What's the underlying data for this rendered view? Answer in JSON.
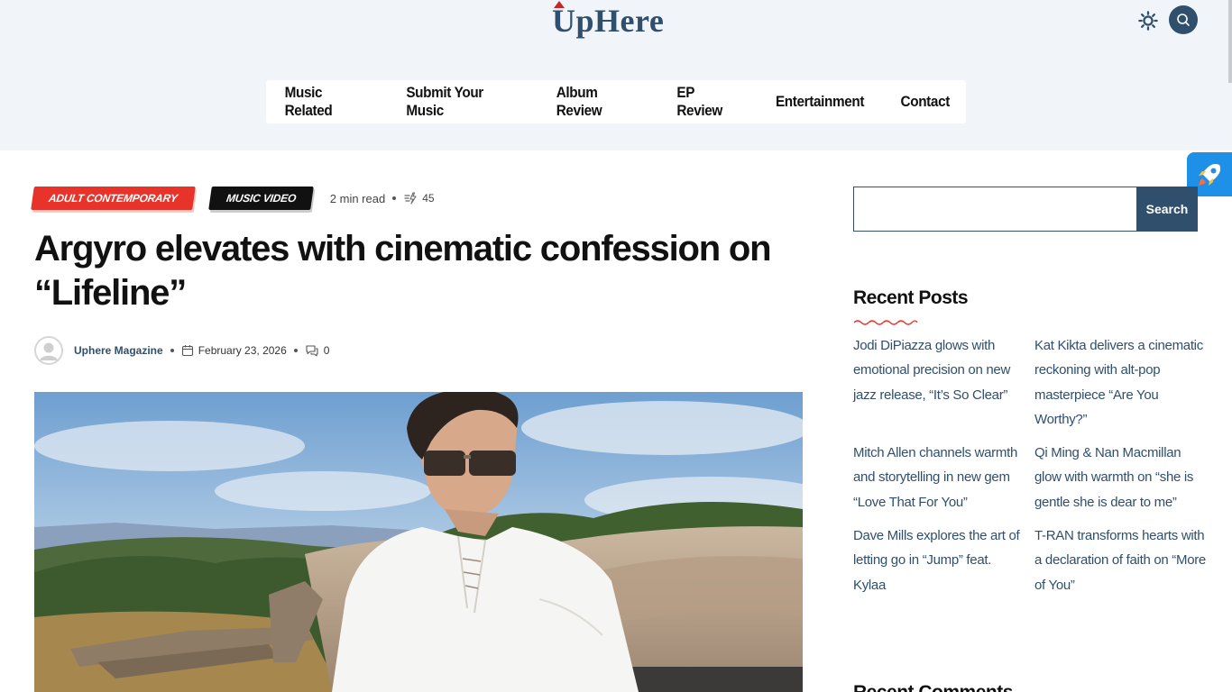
{
  "header": {
    "logo_text": "UpHere",
    "nav": [
      "Music Related",
      "Submit Your Music",
      "Album Review",
      "EP Review",
      "Entertainment",
      "Contact"
    ]
  },
  "article": {
    "tags": [
      "ADULT CONTEMPORARY",
      "MUSIC VIDEO"
    ],
    "read_time": "2 min read",
    "views": "45",
    "title": "Argyro elevates with cinematic confession on “Lifeline”",
    "author": "Uphere Magazine",
    "date": "February 23, 2026",
    "comments": "0"
  },
  "sidebar": {
    "search_button": "Search",
    "search_value": "",
    "recent_posts_title": "Recent Posts",
    "recent_posts": [
      "Jodi DiPiazza glows with emotional precision on new jazz release, “It’s So Clear”",
      "Kat Kikta delivers a cinematic reckoning with alt-pop masterpiece “Are You Worthy?”",
      "Mitch Allen channels warmth and storytelling in new gem “Love That For You”",
      "Qi Ming & Nan Macmillan glow with warmth on “she is gentle she is dear to me”",
      "Dave Mills explores the art of letting go in “Jump” feat. Kylaa",
      "T-RAN transforms hearts with a declaration of faith on “More of You”"
    ],
    "recent_comments_title": "Recent Comments"
  },
  "colors": {
    "brand": "#2f4f6c",
    "tag_red": "#e8332b",
    "rocket_blue": "#1e90e8",
    "header_bg": "#f1f5fa"
  },
  "icons": [
    "sun-icon",
    "search-icon",
    "rocket-icon",
    "views-icon",
    "calendar-icon",
    "comment-icon",
    "avatar-icon"
  ]
}
